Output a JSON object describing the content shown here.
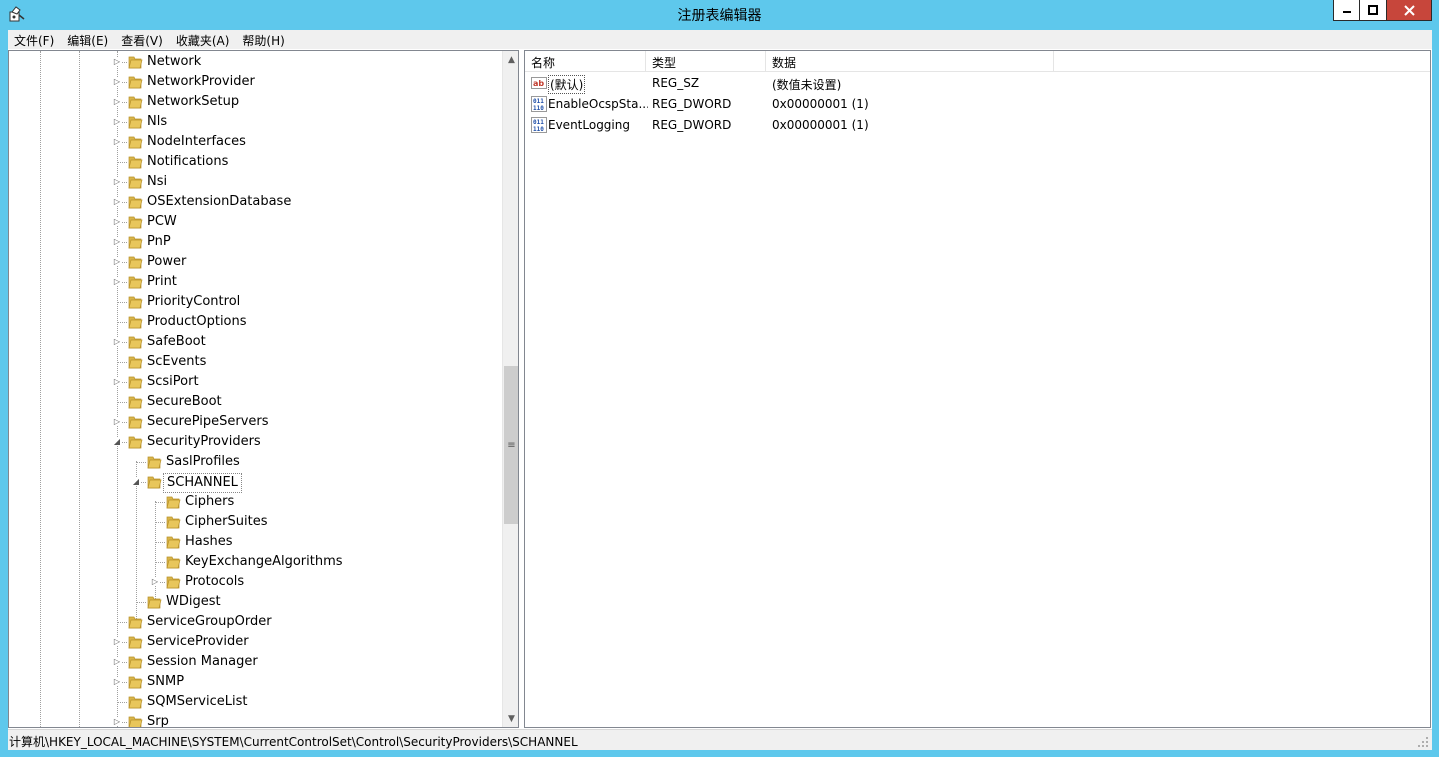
{
  "window": {
    "title": "注册表编辑器",
    "icon": "regedit-icon",
    "buttons": {
      "minimize": "minimize-icon",
      "maximize": "maximize-icon",
      "close": "close-icon"
    },
    "colors": {
      "frame": "#5ec8ec",
      "close_button": "#c7463b",
      "folder": "#e8c65b"
    }
  },
  "menu": {
    "items": [
      "文件(F)",
      "编辑(E)",
      "查看(V)",
      "收藏夹(A)",
      "帮助(H)"
    ]
  },
  "tree": {
    "rows": [
      {
        "label": "Network",
        "level": 0,
        "expander": "collapsed"
      },
      {
        "label": "NetworkProvider",
        "level": 0,
        "expander": "collapsed"
      },
      {
        "label": "NetworkSetup",
        "level": 0,
        "expander": "collapsed"
      },
      {
        "label": "Nls",
        "level": 0,
        "expander": "collapsed"
      },
      {
        "label": "NodeInterfaces",
        "level": 0,
        "expander": "collapsed"
      },
      {
        "label": "Notifications",
        "level": 0,
        "expander": "none"
      },
      {
        "label": "Nsi",
        "level": 0,
        "expander": "collapsed"
      },
      {
        "label": "OSExtensionDatabase",
        "level": 0,
        "expander": "collapsed"
      },
      {
        "label": "PCW",
        "level": 0,
        "expander": "collapsed"
      },
      {
        "label": "PnP",
        "level": 0,
        "expander": "collapsed"
      },
      {
        "label": "Power",
        "level": 0,
        "expander": "collapsed"
      },
      {
        "label": "Print",
        "level": 0,
        "expander": "collapsed"
      },
      {
        "label": "PriorityControl",
        "level": 0,
        "expander": "none"
      },
      {
        "label": "ProductOptions",
        "level": 0,
        "expander": "none"
      },
      {
        "label": "SafeBoot",
        "level": 0,
        "expander": "collapsed"
      },
      {
        "label": "ScEvents",
        "level": 0,
        "expander": "none"
      },
      {
        "label": "ScsiPort",
        "level": 0,
        "expander": "collapsed"
      },
      {
        "label": "SecureBoot",
        "level": 0,
        "expander": "none"
      },
      {
        "label": "SecurePipeServers",
        "level": 0,
        "expander": "collapsed"
      },
      {
        "label": "SecurityProviders",
        "level": 0,
        "expander": "expanded"
      },
      {
        "label": "SaslProfiles",
        "level": 1,
        "expander": "none"
      },
      {
        "label": "SCHANNEL",
        "level": 1,
        "expander": "expanded",
        "selected": true
      },
      {
        "label": "Ciphers",
        "level": 2,
        "expander": "none"
      },
      {
        "label": "CipherSuites",
        "level": 2,
        "expander": "none"
      },
      {
        "label": "Hashes",
        "level": 2,
        "expander": "none"
      },
      {
        "label": "KeyExchangeAlgorithms",
        "level": 2,
        "expander": "none"
      },
      {
        "label": "Protocols",
        "level": 2,
        "expander": "collapsed"
      },
      {
        "label": "WDigest",
        "level": 1,
        "expander": "none"
      },
      {
        "label": "ServiceGroupOrder",
        "level": 0,
        "expander": "none"
      },
      {
        "label": "ServiceProvider",
        "level": 0,
        "expander": "collapsed"
      },
      {
        "label": "Session Manager",
        "level": 0,
        "expander": "collapsed"
      },
      {
        "label": "SNMP",
        "level": 0,
        "expander": "collapsed"
      },
      {
        "label": "SQMServiceList",
        "level": 0,
        "expander": "none"
      },
      {
        "label": "Srp",
        "level": 0,
        "expander": "collapsed"
      }
    ]
  },
  "values": {
    "columns": [
      "名称",
      "类型",
      "数据"
    ],
    "rows": [
      {
        "name": "(默认)",
        "type": "REG_SZ",
        "data": "(数值未设置)",
        "icon": "string-value-icon"
      },
      {
        "name": "EnableOcspSta...",
        "type": "REG_DWORD",
        "data": "0x00000001 (1)",
        "icon": "binary-value-icon"
      },
      {
        "name": "EventLogging",
        "type": "REG_DWORD",
        "data": "0x00000001 (1)",
        "icon": "binary-value-icon"
      }
    ]
  },
  "status": {
    "path": "计算机\\HKEY_LOCAL_MACHINE\\SYSTEM\\CurrentControlSet\\Control\\SecurityProviders\\SCHANNEL"
  }
}
